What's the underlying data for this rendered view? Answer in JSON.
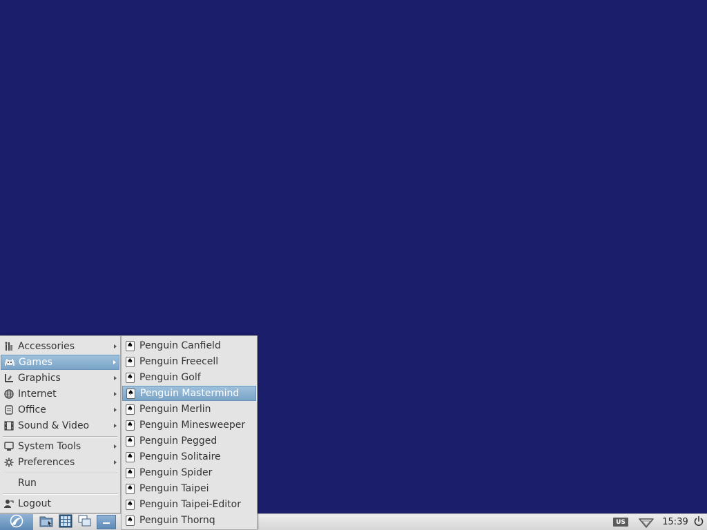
{
  "main_menu": {
    "items": [
      {
        "label": "Accessories",
        "icon": "accessories-icon",
        "submenu": true
      },
      {
        "label": "Games",
        "icon": "games-icon",
        "submenu": true,
        "active": true
      },
      {
        "label": "Graphics",
        "icon": "graphics-icon",
        "submenu": true
      },
      {
        "label": "Internet",
        "icon": "internet-icon",
        "submenu": true
      },
      {
        "label": "Office",
        "icon": "office-icon",
        "submenu": true
      },
      {
        "label": "Sound & Video",
        "icon": "sound-video-icon",
        "submenu": true
      },
      {
        "label": "System Tools",
        "icon": "system-tools-icon",
        "submenu": true
      },
      {
        "label": "Preferences",
        "icon": "preferences-icon",
        "submenu": true
      },
      {
        "label": "Run",
        "icon": "",
        "submenu": false
      },
      {
        "label": "Logout",
        "icon": "logout-icon",
        "submenu": false
      }
    ]
  },
  "games_menu": {
    "icon": "spade-card-icon",
    "items": [
      {
        "label": "Penguin Canfield"
      },
      {
        "label": "Penguin Freecell"
      },
      {
        "label": "Penguin Golf"
      },
      {
        "label": "Penguin Mastermind",
        "active": true
      },
      {
        "label": "Penguin Merlin"
      },
      {
        "label": "Penguin Minesweeper"
      },
      {
        "label": "Penguin Pegged"
      },
      {
        "label": "Penguin Solitaire"
      },
      {
        "label": "Penguin Spider"
      },
      {
        "label": "Penguin Taipei"
      },
      {
        "label": "Penguin Taipei-Editor"
      },
      {
        "label": "Penguin Thornq"
      }
    ]
  },
  "taskbar": {
    "keyboard_layout": "US",
    "clock": "15:39",
    "launchers": [
      "file-manager-icon",
      "terminal-icon",
      "window-switcher-icon"
    ],
    "task_icon": "minimize-icon"
  },
  "colors": {
    "desktop": "#1b1f6b",
    "menu_bg": "#e4e4e4",
    "highlight": "#7aa4c8"
  }
}
